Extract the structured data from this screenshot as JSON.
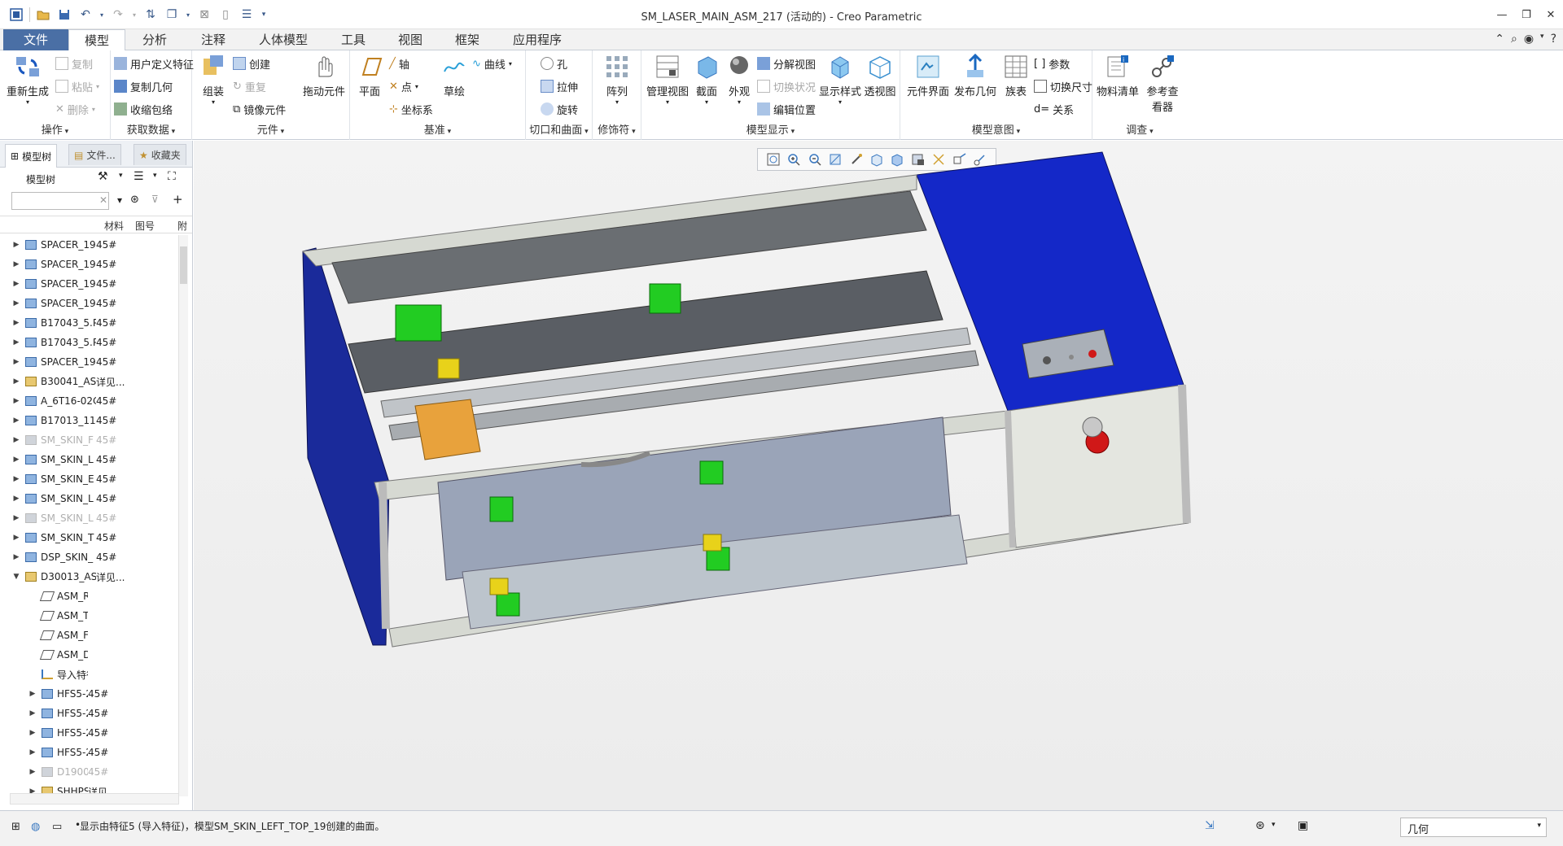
{
  "window": {
    "title": "SM_LASER_MAIN_ASM_217 (活动的) - Creo Parametric"
  },
  "tabs": [
    {
      "label": "文件"
    },
    {
      "label": "模型"
    },
    {
      "label": "分析"
    },
    {
      "label": "注释"
    },
    {
      "label": "人体模型"
    },
    {
      "label": "工具"
    },
    {
      "label": "视图"
    },
    {
      "label": "框架"
    },
    {
      "label": "应用程序"
    }
  ],
  "ribbon": {
    "operations": {
      "regen": "重新生成",
      "copy": "复制",
      "paste": "粘贴",
      "delete": "删除",
      "footer": "操作"
    },
    "get_data": {
      "udf": "用户定义特征",
      "copy_geom": "复制几何",
      "shrinkwrap": "收缩包络",
      "footer": "获取数据"
    },
    "component": {
      "assemble": "组装",
      "create": "创建",
      "repeat": "重复",
      "mirror": "镜像元件",
      "drag": "拖动元件",
      "footer": "元件"
    },
    "datum": {
      "plane": "平面",
      "axis": "轴",
      "point": "点",
      "csys": "坐标系",
      "sketch": "草绘",
      "curve": "曲线",
      "footer": "基准"
    },
    "cut_surface": {
      "hole": "孔",
      "extrude": "拉伸",
      "revolve": "旋转",
      "footer": "切口和曲面"
    },
    "modifiers": {
      "pattern": "阵列",
      "footer": "修饰符"
    },
    "model_display": {
      "manage_views": "管理视图",
      "section": "截面",
      "appearance": "外观",
      "explode": "分解视图",
      "toggle_status": "切换状况",
      "edit_position": "编辑位置",
      "display_style": "显示样式",
      "perspective": "透视图",
      "footer": "模型显示"
    },
    "model_intent": {
      "comp_interface": "元件界面",
      "publish_geom": "发布几何",
      "family_table": "族表",
      "params": "参数",
      "switch_dims": "切换尺寸",
      "relations": "关系",
      "footer": "模型意图"
    },
    "investigate": {
      "bom": "物料清单",
      "ref_viewer": "参考查看器",
      "footer": "调查"
    }
  },
  "nav": {
    "tabs": [
      {
        "label": "模型树"
      },
      {
        "label": "文件..."
      },
      {
        "label": "收藏夹"
      }
    ],
    "tree_label": "模型树",
    "search_value": "",
    "columns": {
      "material": "材料",
      "drawing_no": "图号",
      "attach": "附"
    }
  },
  "tree": [
    {
      "name": "SPACER_19",
      "mat": "45#",
      "dim": false,
      "expanded": false,
      "indent": 0,
      "type": "part"
    },
    {
      "name": "SPACER_19",
      "mat": "45#",
      "dim": false,
      "expanded": false,
      "indent": 0,
      "type": "part"
    },
    {
      "name": "SPACER_19",
      "mat": "45#",
      "dim": false,
      "expanded": false,
      "indent": 0,
      "type": "part"
    },
    {
      "name": "SPACER_19",
      "mat": "45#",
      "dim": false,
      "expanded": false,
      "indent": 0,
      "type": "part"
    },
    {
      "name": "B17043_5.P",
      "mat": "45#",
      "dim": false,
      "expanded": false,
      "indent": 0,
      "type": "part"
    },
    {
      "name": "B17043_5.P",
      "mat": "45#",
      "dim": false,
      "expanded": false,
      "indent": 0,
      "type": "part"
    },
    {
      "name": "SPACER_19",
      "mat": "45#",
      "dim": false,
      "expanded": false,
      "indent": 0,
      "type": "part"
    },
    {
      "name": "B30041_AS",
      "mat": "详见...",
      "dim": false,
      "expanded": false,
      "indent": 0,
      "type": "asm"
    },
    {
      "name": "A_6T16-02C",
      "mat": "45#",
      "dim": false,
      "expanded": false,
      "indent": 0,
      "type": "part"
    },
    {
      "name": "B17013_11.",
      "mat": "45#",
      "dim": false,
      "expanded": false,
      "indent": 0,
      "type": "part"
    },
    {
      "name": "SM_SKIN_F",
      "mat": "45#",
      "dim": true,
      "expanded": false,
      "indent": 0,
      "type": "part"
    },
    {
      "name": "SM_SKIN_L",
      "mat": "45#",
      "dim": false,
      "expanded": false,
      "indent": 0,
      "type": "part"
    },
    {
      "name": "SM_SKIN_E",
      "mat": "45#",
      "dim": false,
      "expanded": false,
      "indent": 0,
      "type": "part"
    },
    {
      "name": "SM_SKIN_L",
      "mat": "45#",
      "dim": false,
      "expanded": false,
      "indent": 0,
      "type": "part"
    },
    {
      "name": "SM_SKIN_L",
      "mat": "45#",
      "dim": true,
      "expanded": false,
      "indent": 0,
      "type": "part"
    },
    {
      "name": "SM_SKIN_T",
      "mat": "45#",
      "dim": false,
      "expanded": false,
      "indent": 0,
      "type": "part"
    },
    {
      "name": "DSP_SKIN_",
      "mat": "45#",
      "dim": false,
      "expanded": false,
      "indent": 0,
      "type": "part"
    },
    {
      "name": "D30013_AS",
      "mat": "详见...",
      "dim": false,
      "expanded": true,
      "indent": 0,
      "type": "asm"
    },
    {
      "name": "ASM_RI",
      "mat": "",
      "dim": false,
      "expanded": null,
      "indent": 1,
      "type": "plane"
    },
    {
      "name": "ASM_TC",
      "mat": "",
      "dim": false,
      "expanded": null,
      "indent": 1,
      "type": "plane"
    },
    {
      "name": "ASM_FR",
      "mat": "",
      "dim": false,
      "expanded": null,
      "indent": 1,
      "type": "plane"
    },
    {
      "name": "ASM_DE",
      "mat": "",
      "dim": false,
      "expanded": null,
      "indent": 1,
      "type": "plane"
    },
    {
      "name": "导入特征",
      "mat": "",
      "dim": false,
      "expanded": null,
      "indent": 1,
      "type": "import"
    },
    {
      "name": "HFS5-2(",
      "mat": "45#",
      "dim": false,
      "expanded": false,
      "indent": 1,
      "type": "part"
    },
    {
      "name": "HFS5-2(",
      "mat": "45#",
      "dim": false,
      "expanded": false,
      "indent": 1,
      "type": "part"
    },
    {
      "name": "HFS5-2(",
      "mat": "45#",
      "dim": false,
      "expanded": false,
      "indent": 1,
      "type": "part"
    },
    {
      "name": "HFS5-2(",
      "mat": "45#",
      "dim": false,
      "expanded": false,
      "indent": 1,
      "type": "part"
    },
    {
      "name": "D19007",
      "mat": "45#",
      "dim": true,
      "expanded": false,
      "indent": 1,
      "type": "part"
    },
    {
      "name": "SHHPSL",
      "mat": "详见...",
      "dim": false,
      "expanded": false,
      "indent": 1,
      "type": "asm"
    }
  ],
  "status": {
    "message": "显示由特征5 (导入特征)，模型SM_SKIN_LEFT_TOP_19创建的曲面。",
    "filter": "几何"
  },
  "colors": {
    "file_tab": "#4a6fa5",
    "skin_blue": "#1428c8",
    "frame_gray": "#c8ccc4",
    "clamp_green": "#22cc22",
    "bracket_yellow": "#e8d21a",
    "plate_orange": "#e8a23c",
    "estop_red": "#d01818"
  }
}
